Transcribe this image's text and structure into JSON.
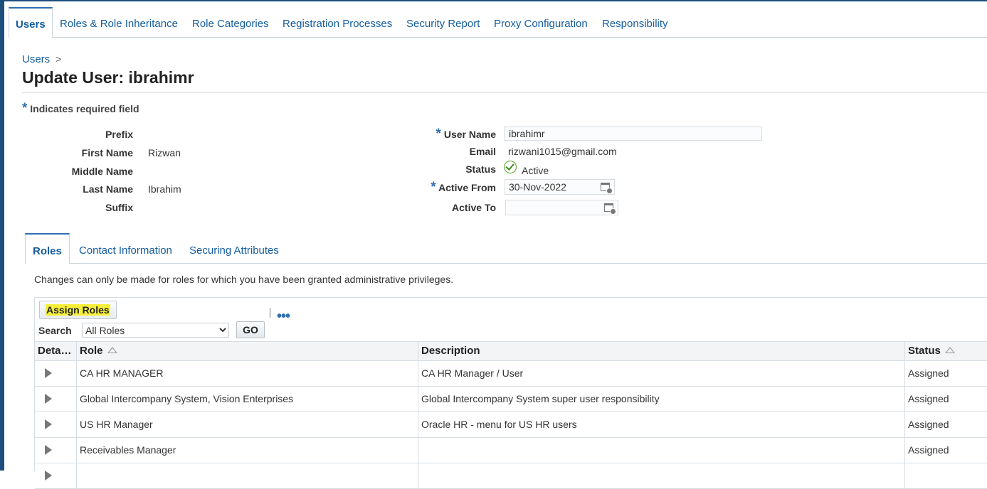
{
  "main_tabs": [
    {
      "label": "Users",
      "active": true
    },
    {
      "label": "Roles & Role Inheritance"
    },
    {
      "label": "Role Categories"
    },
    {
      "label": "Registration Processes"
    },
    {
      "label": "Security Report"
    },
    {
      "label": "Proxy Configuration"
    },
    {
      "label": "Responsibility"
    }
  ],
  "breadcrumb": {
    "link": "Users",
    "separator": ">"
  },
  "page_title": "Update User: ibrahimr",
  "required_note": {
    "star": "*",
    "text": "Indicates required field"
  },
  "left_fields": {
    "prefix": {
      "label": "Prefix",
      "value": ""
    },
    "first_name": {
      "label": "First Name",
      "value": "Rizwan"
    },
    "middle_name": {
      "label": "Middle Name",
      "value": ""
    },
    "last_name": {
      "label": "Last Name",
      "value": "Ibrahim"
    },
    "suffix": {
      "label": "Suffix",
      "value": ""
    }
  },
  "right_fields": {
    "user_name": {
      "label": "User Name",
      "value": "ibrahimr",
      "required": true
    },
    "email": {
      "label": "Email",
      "value": "rizwani1015@gmail.com"
    },
    "status": {
      "label": "Status",
      "value": "Active",
      "icon": "check-icon"
    },
    "active_from": {
      "label": "Active From",
      "value": "30-Nov-2022",
      "required": true
    },
    "active_to": {
      "label": "Active To",
      "value": ""
    }
  },
  "sub_tabs": [
    {
      "label": "Roles",
      "active": true
    },
    {
      "label": "Contact Information"
    },
    {
      "label": "Securing Attributes"
    }
  ],
  "roles_note": "Changes can only be made for roles for which you have been granted administrative privileges.",
  "toolbar": {
    "assign_roles": "Assign Roles",
    "separator": "|",
    "more": "•••",
    "search_label": "Search",
    "search_selected": "All Roles",
    "go": "GO"
  },
  "table": {
    "columns": [
      "Deta…",
      "Role",
      "Description",
      "Status"
    ],
    "rows": [
      {
        "role": "CA HR MANAGER",
        "description": "CA HR Manager / User",
        "status": "Assigned"
      },
      {
        "role": "Global Intercompany System, Vision Enterprises",
        "description": "Global Intercompany System super user responsibility",
        "status": "Assigned"
      },
      {
        "role": "US HR Manager",
        "description": "Oracle HR - menu for US HR users",
        "status": "Assigned"
      },
      {
        "role": "Receivables Manager",
        "description": "",
        "status": "Assigned"
      },
      {
        "role": "",
        "description": "",
        "status": ""
      }
    ]
  },
  "colors": {
    "accent": "#145c9e",
    "highlight": "#f5ef3a",
    "frame": "#1c4f7d"
  }
}
